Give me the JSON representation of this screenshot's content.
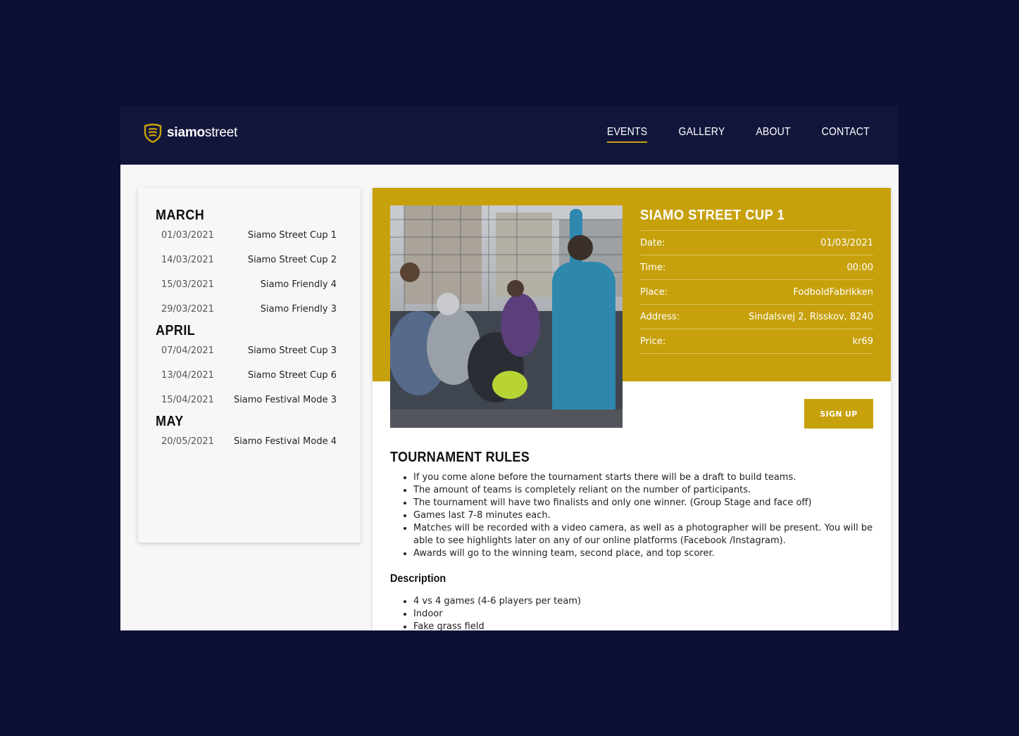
{
  "brand": {
    "name_bold": "siamo",
    "name_light": "street",
    "accent": "#c9a20d"
  },
  "nav": [
    {
      "label": "EVENTS",
      "active": true
    },
    {
      "label": "GALLERY",
      "active": false
    },
    {
      "label": "ABOUT",
      "active": false
    },
    {
      "label": "CONTACT",
      "active": false
    }
  ],
  "sidebar": {
    "months": [
      {
        "name": "MARCH",
        "events": [
          {
            "date": "01/03/2021",
            "title": "Siamo Street Cup 1"
          },
          {
            "date": "14/03/2021",
            "title": "Siamo Street Cup 2"
          },
          {
            "date": "15/03/2021",
            "title": "Siamo Friendly 4"
          },
          {
            "date": "29/03/2021",
            "title": "Siamo Friendly 3"
          }
        ]
      },
      {
        "name": "APRIL",
        "events": [
          {
            "date": "07/04/2021",
            "title": "Siamo Street Cup 3"
          },
          {
            "date": "13/04/2021",
            "title": "Siamo Street Cup 6"
          },
          {
            "date": "15/04/2021",
            "title": "Siamo Festival Mode 3"
          }
        ]
      },
      {
        "name": "MAY",
        "events": [
          {
            "date": "20/05/2021",
            "title": "Siamo Festival Mode 4"
          }
        ]
      }
    ]
  },
  "event": {
    "title": "SIAMO STREET CUP 1",
    "details": [
      {
        "label": "Date:",
        "value": "01/03/2021"
      },
      {
        "label": "Time:",
        "value": "00:00"
      },
      {
        "label": "Place:",
        "value": "FodboldFabrikken"
      },
      {
        "label": "Address:",
        "value": "Sindalsvej 2, Risskov, 8240"
      },
      {
        "label": "Price:",
        "value": "kr69"
      }
    ],
    "signup_label": "SIGN UP",
    "band_color": "#c7a10c"
  },
  "rules": {
    "heading": "TOURNAMENT RULES",
    "items": [
      "If you come alone before the tournament starts there will be a draft to build teams.",
      "The amount of teams is completely reliant on the number of participants.",
      "The tournament will have two finalists and only one winner. (Group Stage and face off)",
      "Games last 7-8 minutes each.",
      "Matches will be recorded with a video camera, as well as a photographer will be present. You will be able to see highlights later on any of our online platforms (Facebook /Instagram).",
      "Awards will go to the winning team, second place, and top scorer."
    ]
  },
  "description": {
    "heading": "Description",
    "items": [
      "4 vs 4 games (4-6 players per team)",
      "Indoor",
      "Fake grass field"
    ]
  }
}
